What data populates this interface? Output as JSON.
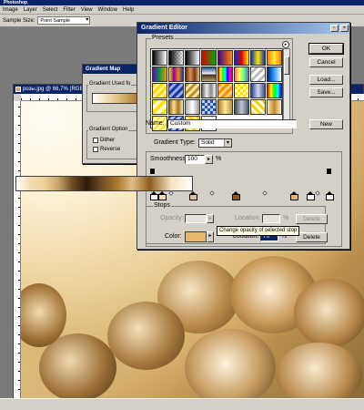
{
  "app": {
    "title": "Photoshop"
  },
  "menu": [
    "Image",
    "Layer",
    "Select",
    "Filter",
    "View",
    "Window",
    "Help"
  ],
  "options_bar": {
    "sample_size_label": "Sample Size:",
    "sample_size_value": "Point Sample"
  },
  "document": {
    "title": "розы.jpg @ 66,7% (RGB)"
  },
  "gradient_map": {
    "title": "Gradient Map",
    "group_used": "Gradient Used fo",
    "group_options": "Gradient Option",
    "dither_label": "Dither",
    "reverse_label": "Reverse"
  },
  "gradient_editor": {
    "title": "Gradient Editor",
    "presets_label": "Presets",
    "buttons": {
      "ok": "OK",
      "cancel": "Cancel",
      "load": "Load...",
      "save": "Save...",
      "new": "New",
      "delete": "Delete",
      "delete2": "Delete"
    },
    "name_label": "Name:",
    "name_value": "Custom",
    "gradient_type_label": "Gradient Type:",
    "gradient_type_value": "Solid",
    "smoothness_label": "Smoothness:",
    "smoothness_value": "100",
    "percent": "%",
    "stops_label": "Stops",
    "opacity_label": "Opacity:",
    "location_label": "Location:",
    "color_label": "Color:",
    "color_location_value": "70",
    "tooltip": "Change opacity of selected stop"
  },
  "colors": {
    "selected_stop": "#e8b86a",
    "titlebar": "#0a246a",
    "dialog_bg": "#d4d0c8"
  },
  "presets": [
    "fg-bg",
    "fg-transparent",
    "black-white",
    "red-green",
    "violet-orange",
    "blue-red-yellow",
    "blue-yellow-blue",
    "orange-yellow-orange",
    "violet-green-orange",
    "yellow-violet-orange-blue",
    "copper",
    "chrome",
    "spectrum",
    "transparent-rainbow",
    "transparent-stripes",
    "blue-spectrum",
    "yellow-stripes",
    "blue-stripes",
    "gold-stripes",
    "silver",
    "orange-stripes",
    "yellow-check",
    "blue-silver",
    "spectrum-2",
    "yellow-stripes-2",
    "gold",
    "silver-2",
    "blue-check",
    "gold-2",
    "steel",
    "yellow-stripes-3",
    "gold-3",
    "yellow-stripes-4",
    "blue-stripes-2",
    "yellow-stripes-5",
    "transparent"
  ]
}
